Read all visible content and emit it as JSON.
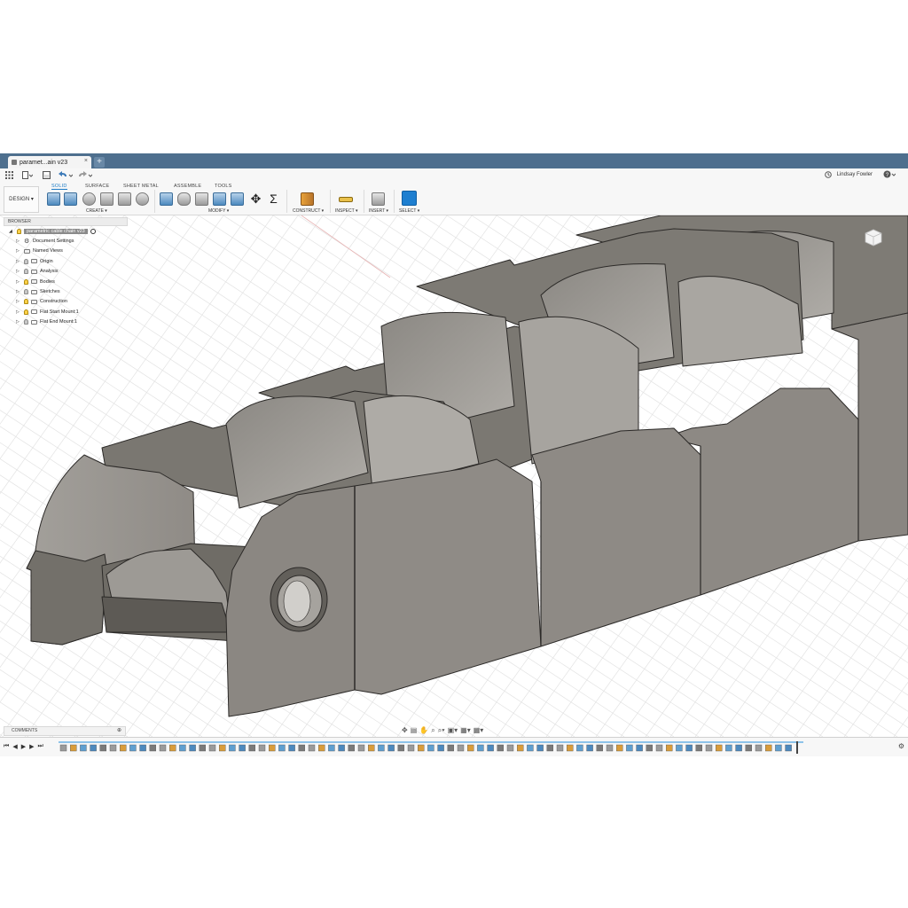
{
  "app": {
    "tab_title": "paramet...ain v23",
    "tab_close": "×",
    "new_tab": "+",
    "user_name": "Lindsay Fowler"
  },
  "icons": {
    "app_menu": "grid-icon",
    "file": "file-icon",
    "save": "save-icon",
    "undo": "undo-icon",
    "redo": "redo-icon",
    "history": "clock-icon",
    "help": "help-icon"
  },
  "ribbon": {
    "workspace": "DESIGN ▾",
    "tabs": [
      "SOLID",
      "SURFACE",
      "SHEET METAL",
      "ASSEMBLE",
      "TOOLS"
    ],
    "active_tab": "SOLID",
    "groups": {
      "create": "CREATE ▾",
      "modify": "MODIFY ▾",
      "construct": "CONSTRUCT ▾",
      "inspect": "INSPECT ▾",
      "insert": "INSERT ▾",
      "select": "SELECT ▾"
    },
    "sigma": "Σ",
    "move": "✥"
  },
  "browser": {
    "header": "BROWSER",
    "root": "parametric cable chain v23",
    "items": [
      {
        "label": "Document Settings",
        "icon": "gear-icon",
        "bulb": false
      },
      {
        "label": "Named Views",
        "icon": "folder-icon",
        "bulb": false
      },
      {
        "label": "Origin",
        "icon": "folder-icon",
        "bulb": true
      },
      {
        "label": "Analysis",
        "icon": "folder-icon",
        "bulb": true
      },
      {
        "label": "Bodies",
        "icon": "folder-icon",
        "bulb": true
      },
      {
        "label": "Sketches",
        "icon": "folder-icon",
        "bulb": true
      },
      {
        "label": "Construction",
        "icon": "folder-icon",
        "bulb": true
      },
      {
        "label": "Flat Start Mount:1",
        "icon": "component-icon",
        "bulb": true
      },
      {
        "label": "Flat End Mount:1",
        "icon": "component-icon",
        "bulb": true
      }
    ]
  },
  "comments": {
    "label": "COMMENTS",
    "control": "⊕"
  },
  "navbar": [
    "✥",
    "▤",
    "✋",
    "⌕",
    "⌕▾",
    "▣▾",
    "▦▾",
    "▦▾"
  ],
  "timeline": {
    "controls": [
      "⏮",
      "◀",
      "▶",
      "▶",
      "⏭"
    ],
    "settings": "⚙"
  },
  "colors": {
    "tabbar": "#4e6f8e",
    "accent": "#1b7ac6",
    "model_face_light": "#8f8b86",
    "model_face_dark": "#6c6964",
    "model_top": "#7d7a74",
    "edge": "#2c2a28"
  }
}
